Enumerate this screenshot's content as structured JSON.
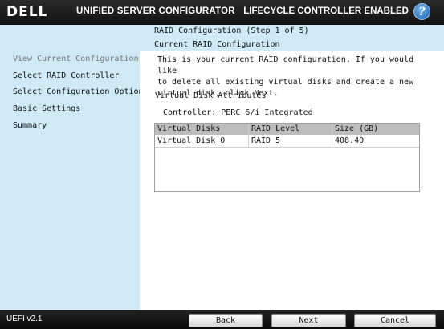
{
  "header": {
    "logo": "DELL",
    "product": "UNIFIED SERVER CONFIGURATOR",
    "status": "LIFECYCLE CONTROLLER ENABLED",
    "help_glyph": "?"
  },
  "wizard": {
    "step": "RAID Configuration (Step 1 of 5)",
    "subtitle": "Current RAID Configuration"
  },
  "sidebar": {
    "items": [
      {
        "label": "View Current Configuration",
        "active": true
      },
      {
        "label": "Select RAID Controller",
        "active": false
      },
      {
        "label": "Select Configuration Option",
        "active": false
      },
      {
        "label": "Basic Settings",
        "active": false
      },
      {
        "label": "Summary",
        "active": false
      }
    ]
  },
  "main": {
    "description_lines": [
      "This is your current RAID configuration. If you would like",
      "to delete all existing virtual disks and create a new",
      "virtual disk, click Next."
    ],
    "section_title": "Virtual Disk Attributes",
    "controller": "Controller:  PERC 6/i Integrated",
    "table": {
      "columns": [
        "Virtual Disks",
        "RAID Level",
        "Size (GB)"
      ],
      "rows": [
        [
          "Virtual Disk 0",
          "RAID 5",
          "408.40"
        ]
      ]
    }
  },
  "footer": {
    "version": "UEFI v2.1",
    "back": "Back",
    "next": "Next",
    "cancel": "Cancel"
  }
}
